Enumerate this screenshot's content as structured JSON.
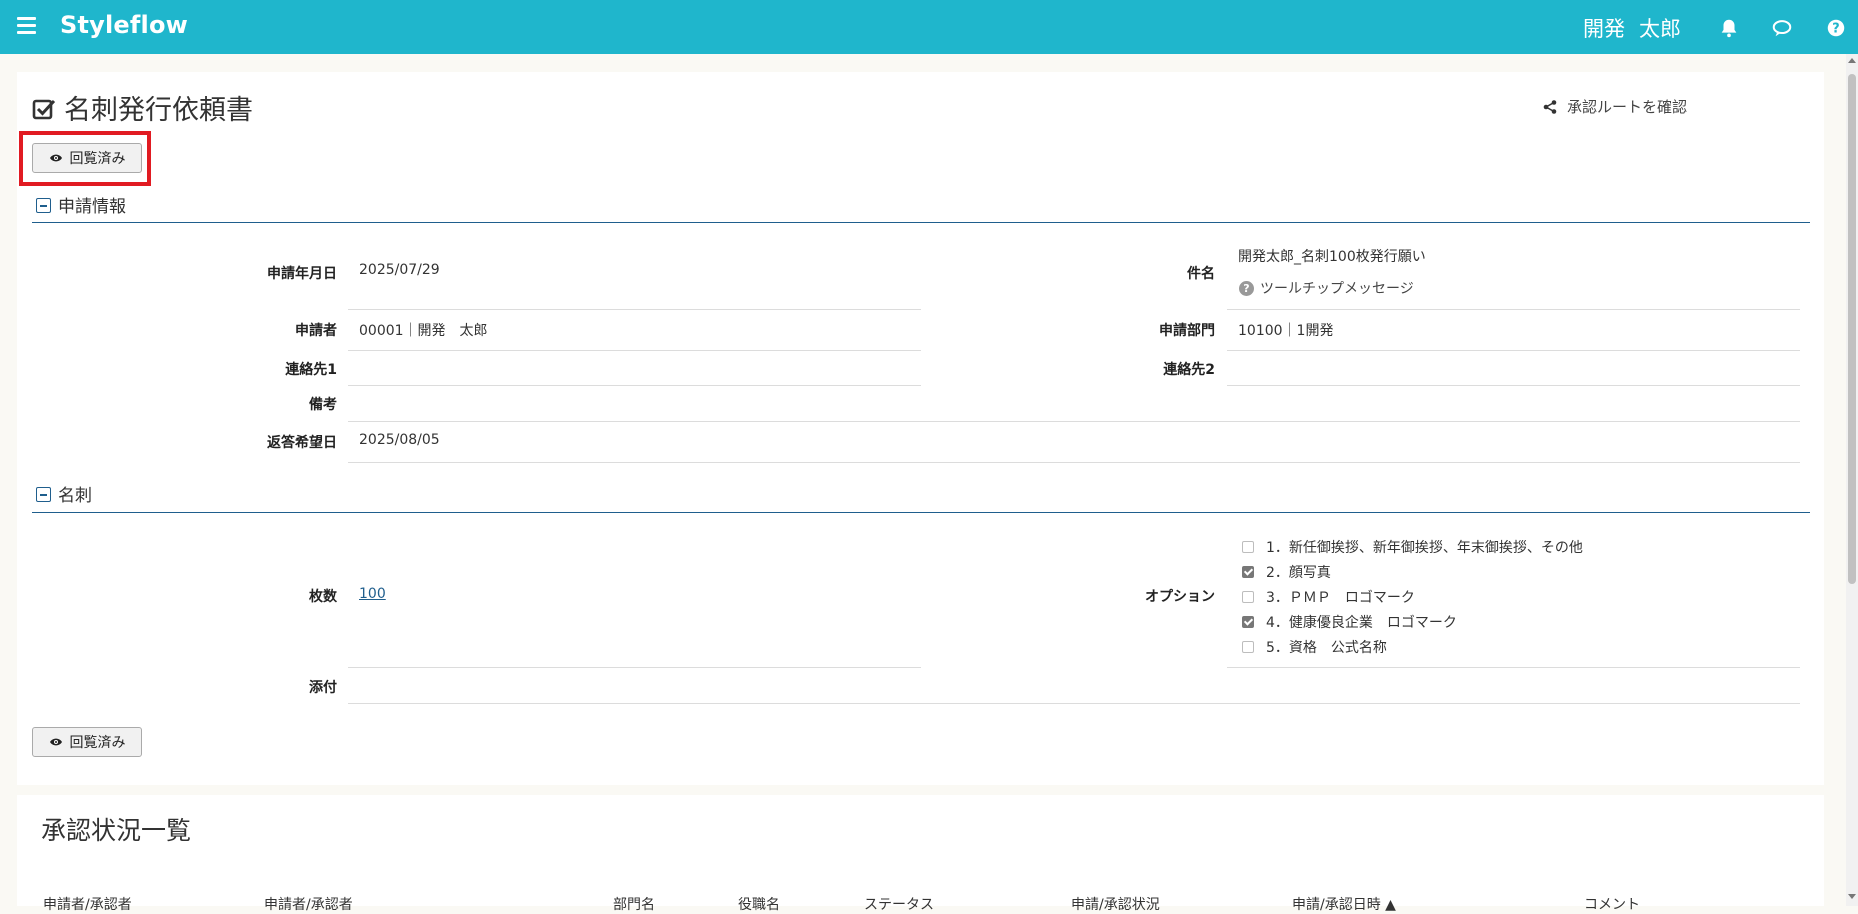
{
  "header": {
    "brand": "Styleflow",
    "user_last": "開発",
    "user_first": "太郎",
    "icons": [
      "menu-icon",
      "bell-icon",
      "chat-icon",
      "help-icon"
    ]
  },
  "page": {
    "title": "名刺発行依頼書",
    "route_link": "承認ルートを確認",
    "viewed_button": "回覧済み"
  },
  "section_application": {
    "title": "申請情報",
    "fields": {
      "date_label": "申請年月日",
      "date_value": "2025/07/29",
      "subject_label": "件名",
      "subject_value": "開発太郎_名刺100枚発行願い",
      "tooltip": "ツールチップメッセージ",
      "applicant_label": "申請者",
      "applicant_value": "00001｜開発　太郎",
      "department_label": "申請部門",
      "department_value": "10100｜1開発",
      "contact1_label": "連絡先1",
      "contact1_value": "",
      "contact2_label": "連絡先2",
      "contact2_value": "",
      "remarks_label": "備考",
      "remarks_value": "",
      "reply_label": "返答希望日",
      "reply_value": "2025/08/05"
    }
  },
  "section_card": {
    "title": "名刺",
    "count_label": "枚数",
    "count_value": "100",
    "options_label": "オプション",
    "options": [
      {
        "label": "1．新任御挨拶、新年御挨拶、年末御挨拶、その他",
        "checked": false
      },
      {
        "label": "2．顔写真",
        "checked": true
      },
      {
        "label": "3．ＰＭＰ　ロゴマーク",
        "checked": false
      },
      {
        "label": "4．健康優良企業　ロゴマーク",
        "checked": true
      },
      {
        "label": "5．資格　公式名称",
        "checked": false
      }
    ],
    "attachment_label": "添付"
  },
  "approval": {
    "title": "承認状況一覧",
    "columns": [
      "申請者/承認者",
      "申請者/承認者",
      "部門名",
      "役職名",
      "ステータス",
      "申請/承認状況",
      "申請/承認日時 ▲",
      "コメント"
    ]
  },
  "colors": {
    "header_bg": "#1fb6cc",
    "section_line": "#1f5e8d",
    "highlight": "#e11b22"
  }
}
